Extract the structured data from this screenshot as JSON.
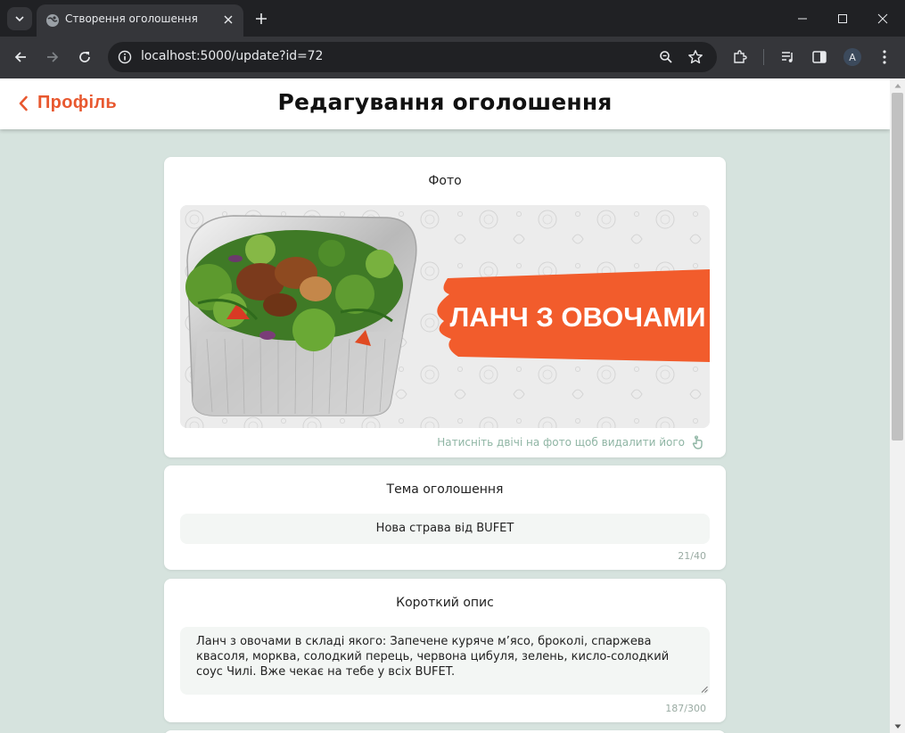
{
  "browser": {
    "tab_title": "Створення оголошення",
    "url": "localhost:5000/update?id=72",
    "profile_initial": "A"
  },
  "header": {
    "back_label": "Профіль",
    "title": "Редагування оголошення"
  },
  "photo_card": {
    "title": "Фото",
    "banner_text": "ЛАНЧ З ОВОЧАМИ",
    "hint": "Натисніть двічі на фото щоб видалити його"
  },
  "subject_card": {
    "title": "Тема оголошення",
    "value": "Нова страва від BUFET",
    "counter": "21/40"
  },
  "description_card": {
    "title": "Короткий опис",
    "value": "Ланч з овочами в складі якого: Запечене куряче м’ясо, броколі, спаржева квасоля, морква, солодкий перець, червона цибуля, зелень, кисло-солодкий соус Чилі. Вже чекає на тебе у всіх BUFET.",
    "counter": "187/300"
  },
  "colors": {
    "accent": "#e8582f",
    "page_bg": "#d6e3de",
    "hint": "#8fb5a4",
    "field_bg": "#f3f6f4",
    "banner": "#f25c2c"
  }
}
